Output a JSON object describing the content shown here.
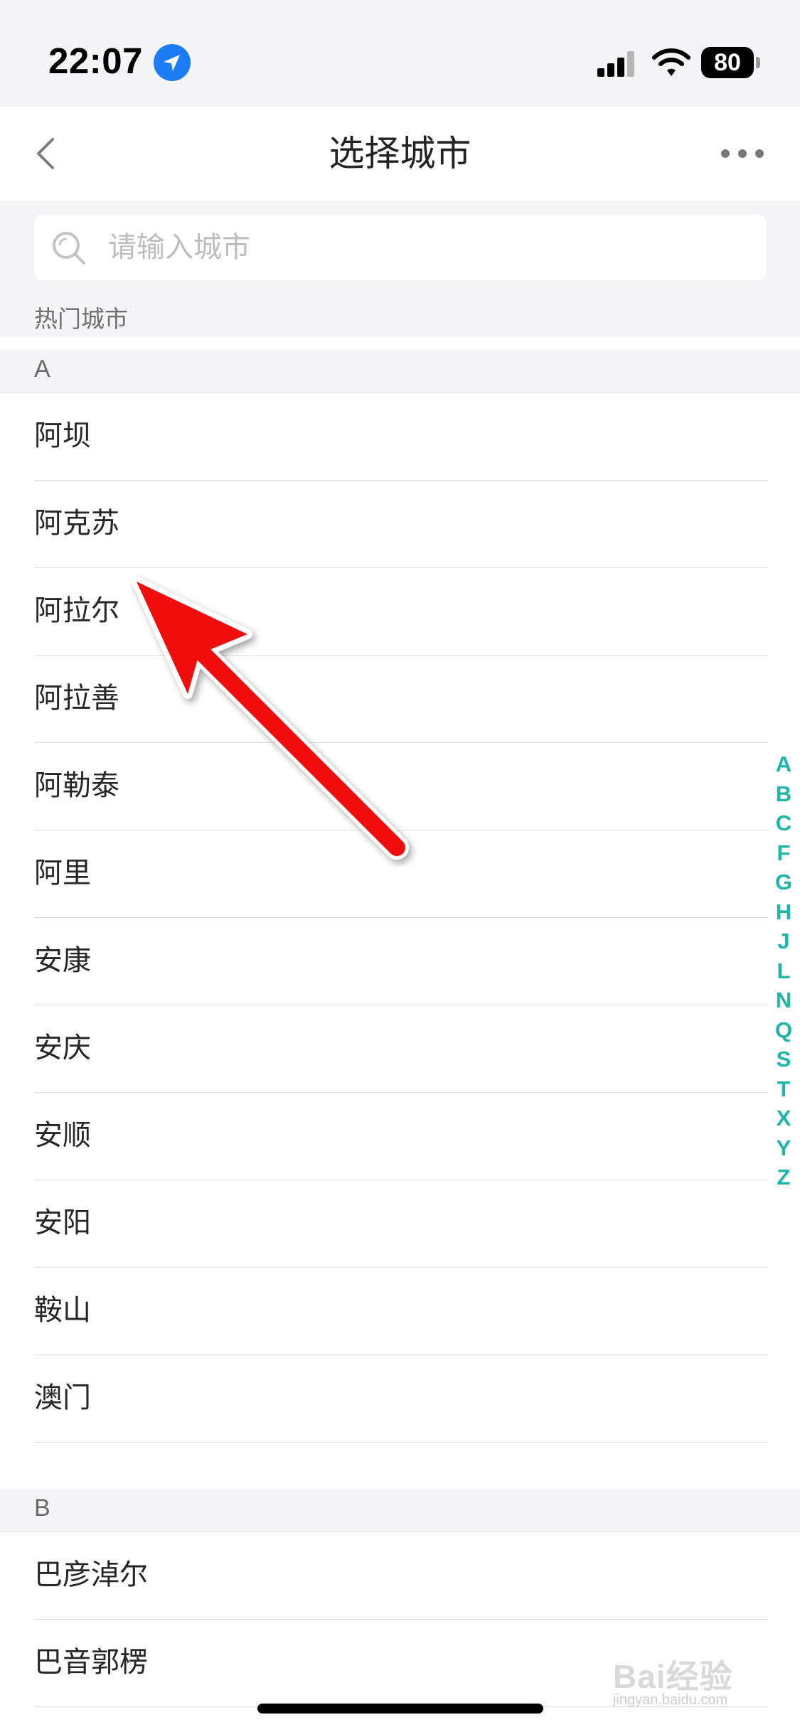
{
  "status_bar": {
    "time": "22:07",
    "battery": "80",
    "icons": [
      "location-arrow-icon",
      "signal-icon",
      "wifi-icon",
      "battery-icon"
    ]
  },
  "nav": {
    "title": "选择城市",
    "back_icon": "chevron-left-icon",
    "more_icon": "more-dots-icon"
  },
  "search": {
    "placeholder": "请输入城市",
    "value": "",
    "icon": "search-icon"
  },
  "hot_cities_label": "热门城市",
  "sections": [
    {
      "letter": "A",
      "cities": [
        "阿坝",
        "阿克苏",
        "阿拉尔",
        "阿拉善",
        "阿勒泰",
        "阿里",
        "安康",
        "安庆",
        "安顺",
        "安阳",
        "鞍山",
        "澳门"
      ]
    },
    {
      "letter": "B",
      "cities": [
        "巴彦淖尔",
        "巴音郭楞"
      ]
    }
  ],
  "index_letters": [
    "A",
    "B",
    "C",
    "F",
    "G",
    "H",
    "J",
    "L",
    "N",
    "Q",
    "S",
    "T",
    "X",
    "Y",
    "Z"
  ],
  "annotation": {
    "arrow_color": "#f20d0d",
    "arrow_icon": "red-arrow-annotation"
  },
  "watermark": {
    "logo": "Bai经验",
    "url": "jingyan.baidu.com"
  },
  "colors": {
    "accent": "#1fb5a9",
    "background": "#f5f5f7",
    "location_blue": "#1b7cf5"
  }
}
